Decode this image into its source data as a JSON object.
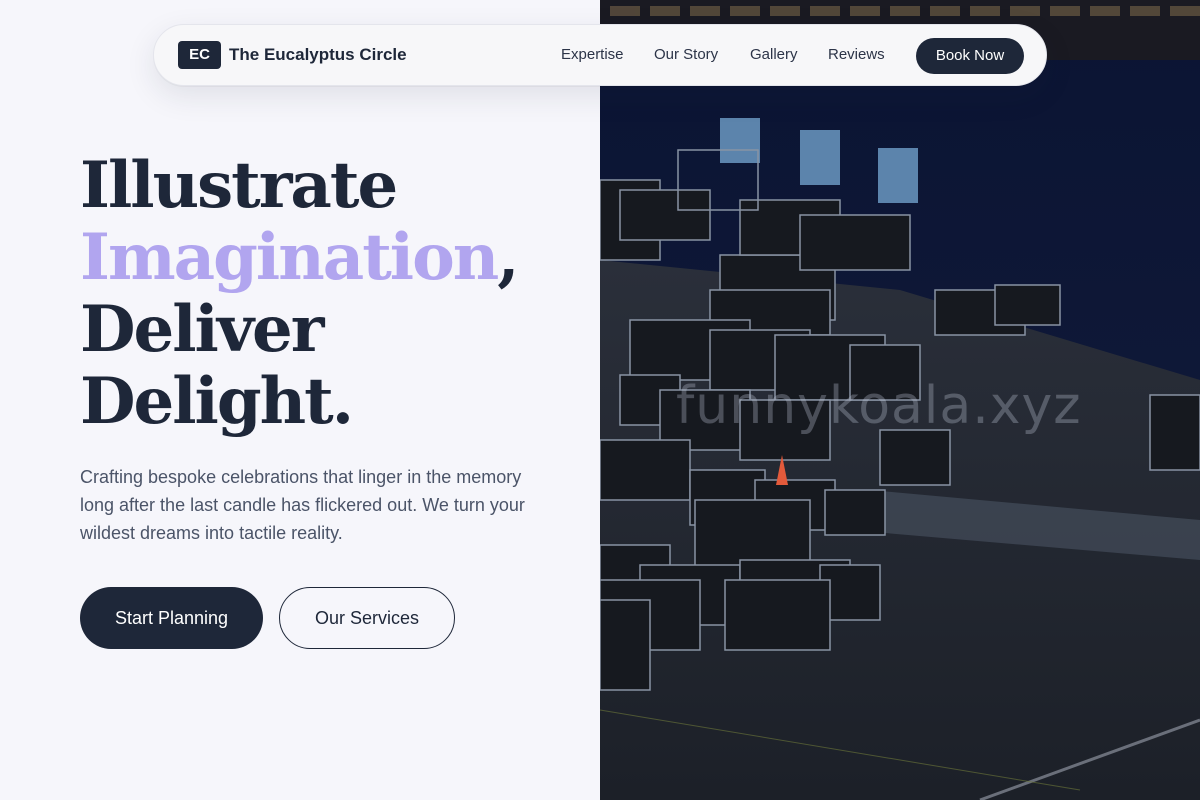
{
  "brand": {
    "logo_initials": "EC",
    "name": "The Eucalyptus Circle"
  },
  "nav": {
    "links": [
      "Expertise",
      "Our Story",
      "Gallery",
      "Reviews"
    ],
    "cta_label": "Book Now"
  },
  "hero": {
    "title_line1": "Illustrate",
    "title_accent": "Imagination",
    "title_comma": ",",
    "title_line3": "Deliver",
    "title_line4": "Delight.",
    "subtitle": "Crafting bespoke celebrations that linger in the memory long after the last candle has flickered out. We turn your wildest dreams into tactile reality.",
    "primary_button": "Start Planning",
    "secondary_button": "Our Services"
  },
  "photo": {
    "watermark": "funnykoala.xyz",
    "icon": "stage-equipment-photo"
  },
  "colors": {
    "background": "#f6f6fb",
    "navy": "#1e2739",
    "accent_lavender": "#b1a5ef",
    "body_text": "#4b5468"
  }
}
